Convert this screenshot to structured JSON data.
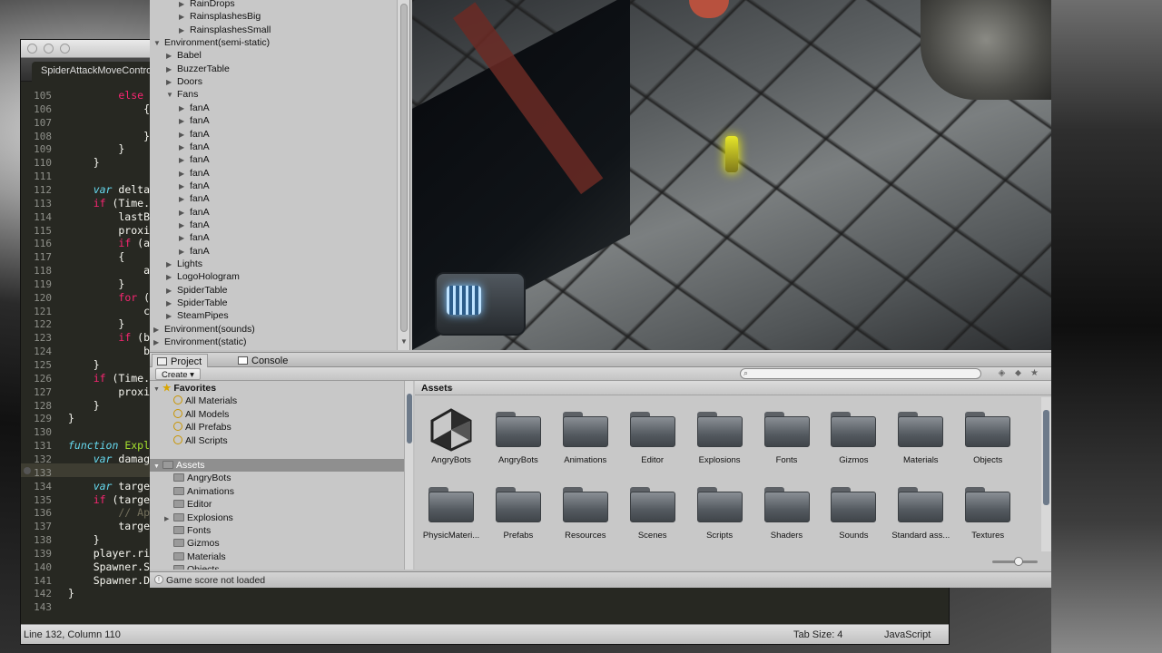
{
  "editor": {
    "tab_title": "SpiderAttackMoveController.js",
    "lines": [
      {
        "n": "105",
        "code": "        else"
      },
      {
        "n": "106",
        "code": "            {"
      },
      {
        "n": "107",
        "code": ""
      },
      {
        "n": "108",
        "code": "            }"
      },
      {
        "n": "109",
        "code": "        }"
      },
      {
        "n": "110",
        "code": "    }"
      },
      {
        "n": "111",
        "code": ""
      },
      {
        "n": "112",
        "code": "    var delta"
      },
      {
        "n": "113",
        "code": "    if (Time."
      },
      {
        "n": "114",
        "code": "        lastB"
      },
      {
        "n": "115",
        "code": "        proxi"
      },
      {
        "n": "116",
        "code": "        if (a"
      },
      {
        "n": "117",
        "code": "        {"
      },
      {
        "n": "118",
        "code": "            a"
      },
      {
        "n": "119",
        "code": "        }"
      },
      {
        "n": "120",
        "code": "        for ("
      },
      {
        "n": "121",
        "code": "            c"
      },
      {
        "n": "122",
        "code": "        }"
      },
      {
        "n": "123",
        "code": "        if (b"
      },
      {
        "n": "124",
        "code": "            b"
      },
      {
        "n": "125",
        "code": "    }"
      },
      {
        "n": "126",
        "code": "    if (Time."
      },
      {
        "n": "127",
        "code": "        proxi"
      },
      {
        "n": "128",
        "code": "    }"
      },
      {
        "n": "129",
        "code": "}"
      },
      {
        "n": "130",
        "code": ""
      },
      {
        "n": "131",
        "code": "function Expl"
      },
      {
        "n": "132",
        "code": "    var damag"
      },
      {
        "n": "133",
        "code": ""
      },
      {
        "n": "134",
        "code": "    var targe"
      },
      {
        "n": "135",
        "code": "    if (targe"
      },
      {
        "n": "136",
        "code": "        // Ap"
      },
      {
        "n": "137",
        "code": "        targe"
      },
      {
        "n": "138",
        "code": "    }"
      },
      {
        "n": "139",
        "code": "    player.ri"
      },
      {
        "n": "140",
        "code": "    Spawner.S"
      },
      {
        "n": "141",
        "code": "    Spawner.Destroy (character.gameObject);"
      },
      {
        "n": "142",
        "code": "}"
      },
      {
        "n": "143",
        "code": ""
      }
    ],
    "status": {
      "position": "Line 132, Column 110",
      "tab_size": "Tab Size: 4",
      "language": "JavaScript"
    }
  },
  "hierarchy": {
    "rows": [
      {
        "label": "RainDrops",
        "indent": 2,
        "arrow": "▶"
      },
      {
        "label": "RainsplashesBig",
        "indent": 2,
        "arrow": "▶"
      },
      {
        "label": "RainsplashesSmall",
        "indent": 2,
        "arrow": "▶"
      },
      {
        "label": "Environment(semi-static)",
        "indent": 0,
        "arrow": "▼"
      },
      {
        "label": "Babel",
        "indent": 1,
        "arrow": "▶"
      },
      {
        "label": "BuzzerTable",
        "indent": 1,
        "arrow": "▶"
      },
      {
        "label": "Doors",
        "indent": 1,
        "arrow": "▶"
      },
      {
        "label": "Fans",
        "indent": 1,
        "arrow": "▼"
      },
      {
        "label": "fanA",
        "indent": 2,
        "arrow": "▶"
      },
      {
        "label": "fanA",
        "indent": 2,
        "arrow": "▶"
      },
      {
        "label": "fanA",
        "indent": 2,
        "arrow": "▶"
      },
      {
        "label": "fanA",
        "indent": 2,
        "arrow": "▶"
      },
      {
        "label": "fanA",
        "indent": 2,
        "arrow": "▶"
      },
      {
        "label": "fanA",
        "indent": 2,
        "arrow": "▶"
      },
      {
        "label": "fanA",
        "indent": 2,
        "arrow": "▶"
      },
      {
        "label": "fanA",
        "indent": 2,
        "arrow": "▶"
      },
      {
        "label": "fanA",
        "indent": 2,
        "arrow": "▶"
      },
      {
        "label": "fanA",
        "indent": 2,
        "arrow": "▶"
      },
      {
        "label": "fanA",
        "indent": 2,
        "arrow": "▶"
      },
      {
        "label": "fanA",
        "indent": 2,
        "arrow": "▶"
      },
      {
        "label": "Lights",
        "indent": 1,
        "arrow": "▶"
      },
      {
        "label": "LogoHologram",
        "indent": 1,
        "arrow": "▶"
      },
      {
        "label": "SpiderTable",
        "indent": 1,
        "arrow": "▶"
      },
      {
        "label": "SpiderTable",
        "indent": 1,
        "arrow": "▶"
      },
      {
        "label": "SteamPipes",
        "indent": 1,
        "arrow": "▶"
      },
      {
        "label": "Environment(sounds)",
        "indent": 0,
        "arrow": "▶"
      },
      {
        "label": "Environment(static)",
        "indent": 0,
        "arrow": "▶"
      }
    ]
  },
  "tabs": {
    "project": "Project",
    "console": "Console"
  },
  "toolbar": {
    "create": "Create"
  },
  "project_tree": {
    "favorites_label": "Favorites",
    "favorites": [
      "All Materials",
      "All Models",
      "All Prefabs",
      "All Scripts"
    ],
    "assets_label": "Assets",
    "assets": [
      "AngryBots",
      "Animations",
      "Editor",
      "Explosions",
      "Fonts",
      "Gizmos",
      "Materials",
      "Objects"
    ]
  },
  "assets_view": {
    "breadcrumb": "Assets",
    "items": [
      {
        "label": "AngryBots",
        "kind": "unity"
      },
      {
        "label": "AngryBots",
        "kind": "folder"
      },
      {
        "label": "Animations",
        "kind": "folder"
      },
      {
        "label": "Editor",
        "kind": "folder"
      },
      {
        "label": "Explosions",
        "kind": "folder"
      },
      {
        "label": "Fonts",
        "kind": "folder"
      },
      {
        "label": "Gizmos",
        "kind": "folder"
      },
      {
        "label": "Materials",
        "kind": "folder"
      },
      {
        "label": "Objects",
        "kind": "folder"
      },
      {
        "label": "PhysicMateri...",
        "kind": "folder"
      },
      {
        "label": "Prefabs",
        "kind": "folder"
      },
      {
        "label": "Resources",
        "kind": "folder"
      },
      {
        "label": "Scenes",
        "kind": "folder"
      },
      {
        "label": "Scripts",
        "kind": "folder"
      },
      {
        "label": "Shaders",
        "kind": "folder"
      },
      {
        "label": "Sounds",
        "kind": "folder"
      },
      {
        "label": "Standard ass...",
        "kind": "folder"
      },
      {
        "label": "Textures",
        "kind": "folder"
      }
    ]
  },
  "status": {
    "message": "Game score not loaded"
  }
}
